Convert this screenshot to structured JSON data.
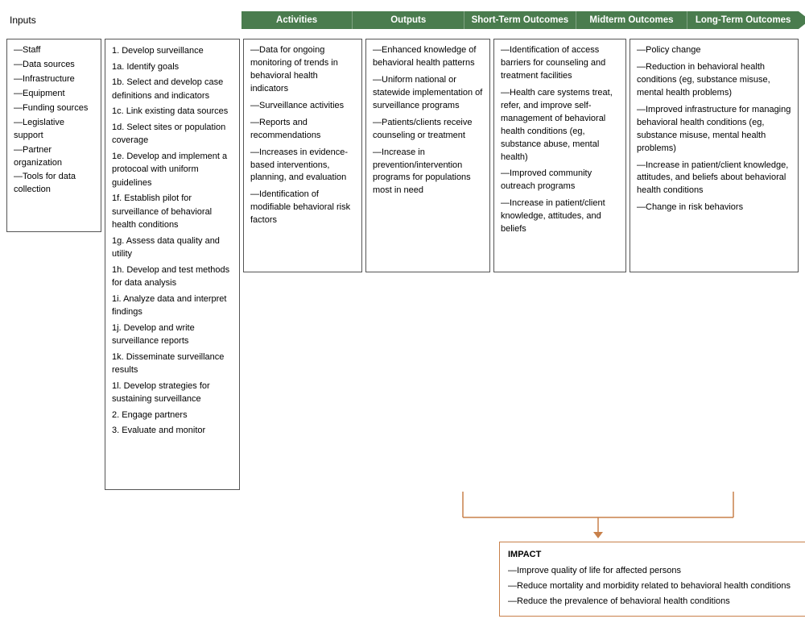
{
  "header": {
    "inputs_label": "Inputs",
    "activities_label": "Activities",
    "outputs_label": "Outputs",
    "short_label": "Short-Term Outcomes",
    "midterm_label": "Midterm Outcomes",
    "longterm_label": "Long-Term Outcomes"
  },
  "inputs": {
    "items": [
      "—Staff",
      "—Data sources",
      "—Infrastructure",
      "—Equipment",
      "—Funding sources",
      "—Legislative support",
      "—Partner organization",
      "—Tools for data collection"
    ]
  },
  "activities": {
    "items": [
      "1. Develop surveillance",
      "1a. Identify goals",
      "1b. Select and develop case definitions and indicators",
      "1c. Link existing data sources",
      "1d. Select sites or population coverage",
      "1e. Develop and implement a protocoal with uniform guidelines",
      "1f. Establish pilot for surveillance of behavioral health conditions",
      "1g. Assess data quality and utility",
      "1h. Develop and test methods for data analysis",
      "1i. Analyze data and interpret findings",
      "1j. Develop and write surveillance reports",
      "1k. Disseminate surveillance results",
      "1l. Develop strategies for sustaining surveillance",
      "2. Engage partners",
      "3. Evaluate and monitor"
    ]
  },
  "outputs": {
    "items": [
      "—Data for ongoing monitoring of trends in behavioral health indicators",
      "—Surveillance activities",
      "—Reports and recommendations",
      "—Increases in evidence-based interventions, planning, and evaluation",
      "—Identification of modifiable behavioral risk factors"
    ]
  },
  "short_outcomes": {
    "items": [
      "—Enhanced knowledge of behavioral health patterns",
      "—Uniform national or statewide implementation of surveillance programs",
      "—Patients/clients receive counseling or treatment",
      "—Increase in prevention/intervention programs for populations most in need"
    ]
  },
  "midterm_outcomes": {
    "items": [
      "—Identification of access barriers for counseling and treatment facilities",
      "—Health care systems treat, refer, and improve self-management of behavioral health conditions (eg, substance abuse, mental health)",
      "—Improved community outreach programs",
      "—Increase in patient/client knowledge, attitudes, and beliefs"
    ]
  },
  "longterm_outcomes": {
    "items": [
      "—Policy change",
      "—Reduction in behavioral health conditions (eg, substance misuse, mental health problems)",
      "—Improved infrastructure for managing behavioral health conditions (eg, substance misuse, mental health problems)",
      "—Increase in patient/client knowledge, attitudes, and beliefs about behavioral health conditions",
      "—Change in risk behaviors"
    ]
  },
  "impact": {
    "title": "IMPACT",
    "items": [
      "—Improve quality of life for affected persons",
      "—Reduce mortality and morbidity related to behavioral health conditions",
      "—Reduce the prevalence of behavioral health conditions"
    ]
  }
}
